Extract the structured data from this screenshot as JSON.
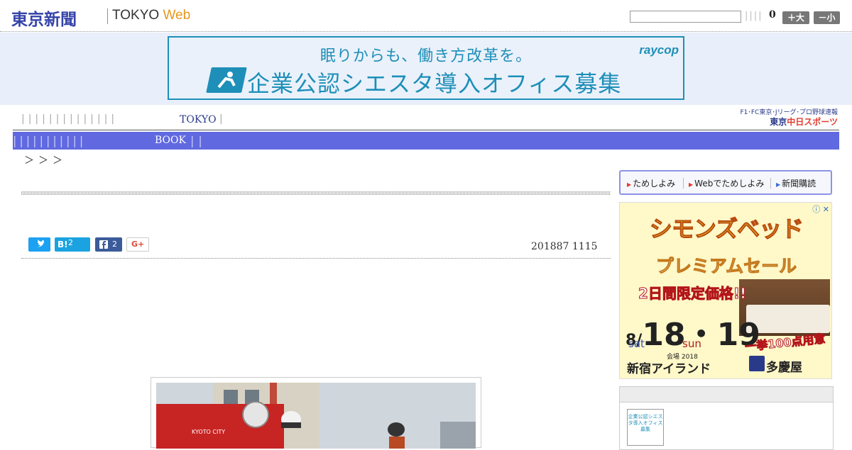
{
  "header": {
    "logo_jp": "東京新聞",
    "logo_en": "TOKYO",
    "logo_web": "Web",
    "search_value": "",
    "separators": "||||",
    "count": "0",
    "font_up_label": "＋大",
    "font_down_label": "－小"
  },
  "top_ad": {
    "line1": "眠りからも、働き方改革を。",
    "brand": "raycop",
    "line2": "企業公認シエスタ導入オフィス募集",
    "accent": "#1e8fb8"
  },
  "nav1": {
    "separators": "||||||||||||||",
    "tokyo_label": "TOKYO",
    "tail": "|"
  },
  "sports": {
    "line1": "F1･FC東京･Jリーグ･プロ野球速報",
    "line2_prefix": "東京",
    "line2_highlight": "中日スポーツ"
  },
  "nav2": {
    "separators": "|||||||||||",
    "book_label": "BOOK",
    "tail": "||",
    "color": "#6069e0"
  },
  "breadcrumb": "＞＞＞",
  "share": {
    "twitter_icon": "twitter-icon",
    "hatena_label": "B!",
    "hatena_count": "2",
    "facebook_icon": "facebook-icon",
    "facebook_count": "2",
    "gplus_label": "G+"
  },
  "article": {
    "date": "201887 1115"
  },
  "side_tabs": [
    {
      "label": "ためしよみ"
    },
    {
      "label": "Webでためしよみ"
    },
    {
      "label": "新聞購読"
    }
  ],
  "side_ad": {
    "title": "シモンズベッド",
    "subtitle": "プレミアムセール",
    "red_label": "2日間限定価格!!",
    "date_main": "8/",
    "date_days": "18・19",
    "dow1": "sat",
    "dow2": "sun",
    "hot_label": "一挙100点用意",
    "venue_tag": "会場",
    "year": "2018",
    "venue": "新宿アイランド",
    "store": "多慶屋",
    "close_label": "ⓘ ✕"
  },
  "side_box": {
    "thumb_text": "企業公認シエスタ導入オフィス募集"
  }
}
